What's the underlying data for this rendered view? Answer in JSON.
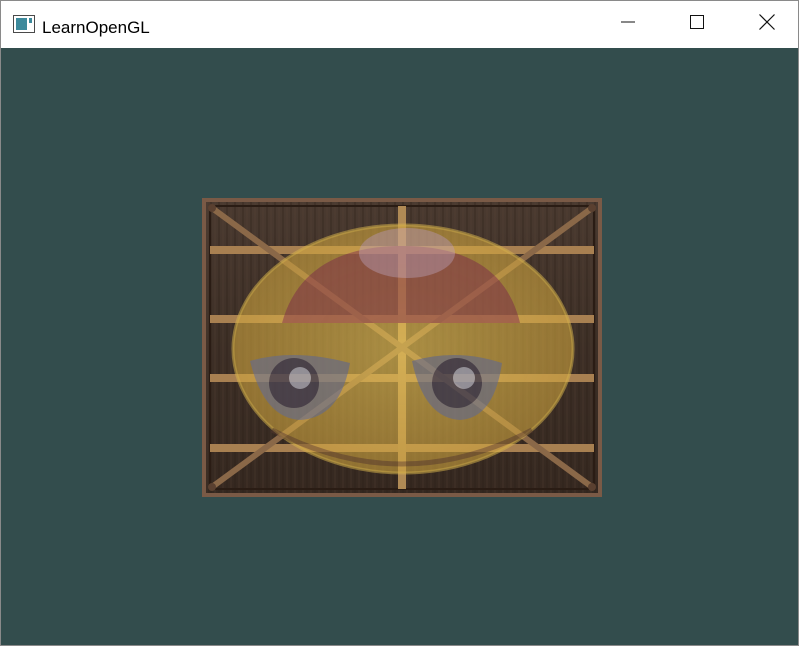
{
  "window": {
    "title": "LearnOpenGL",
    "clear_color": "#334d4d"
  },
  "controls": {
    "minimize_icon": "minimize-icon",
    "maximize_icon": "maximize-icon",
    "close_icon": "close-icon"
  },
  "scene": {
    "textures": [
      "wooden-container-texture",
      "awesomeface-texture"
    ],
    "blend_note_colors": {
      "wood_dark": "#3e2c22",
      "wood_plank": "#b88c4e",
      "face_yellow": "#e2c050",
      "face_red": "#9c4a4e"
    }
  }
}
